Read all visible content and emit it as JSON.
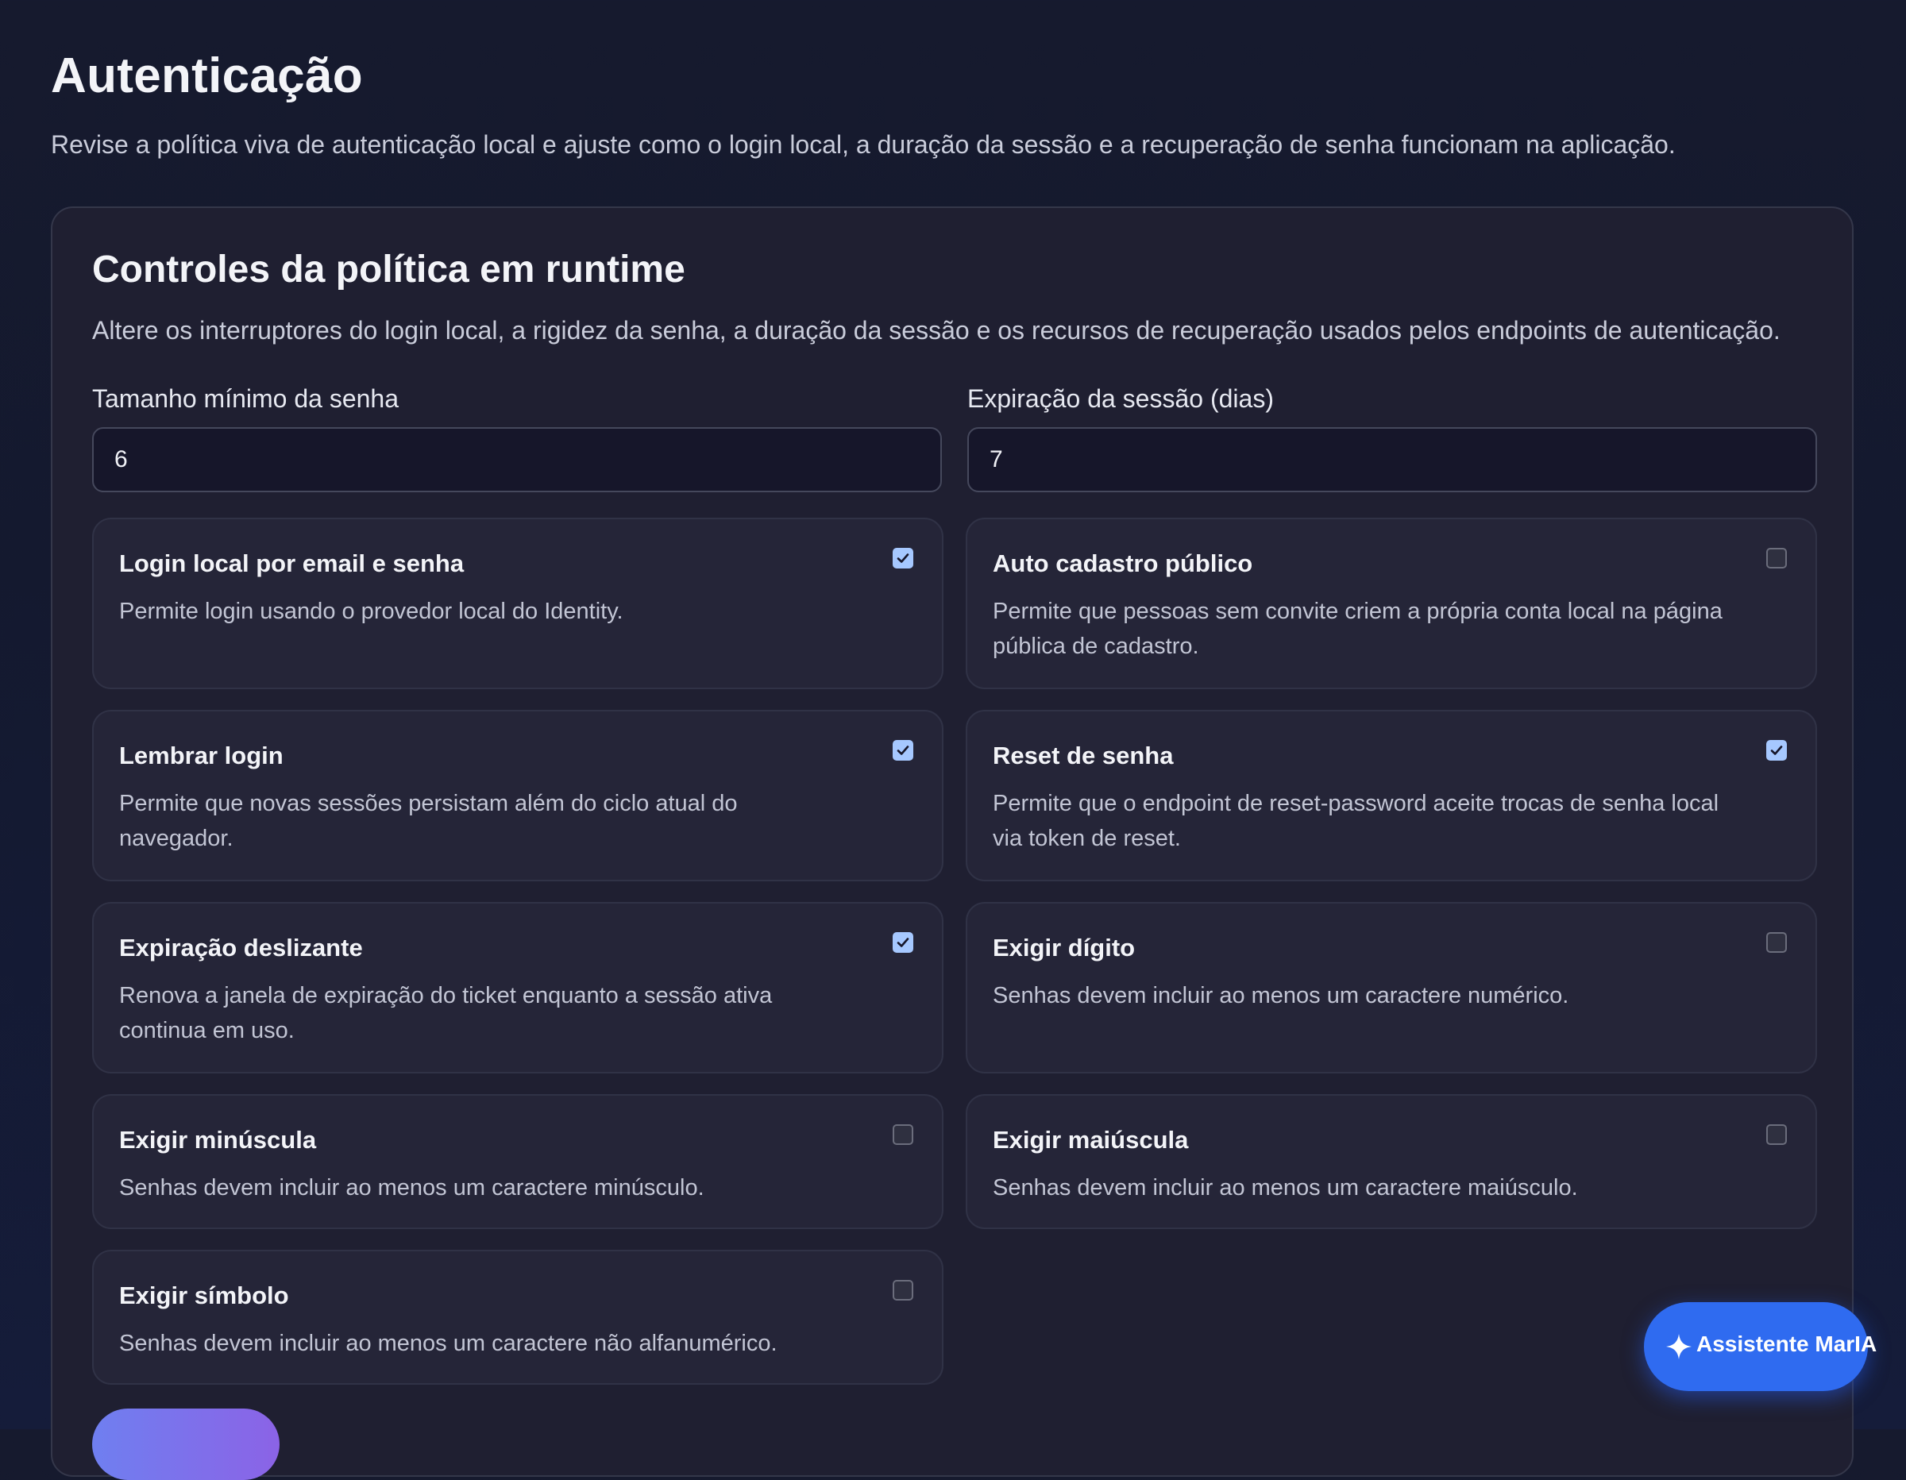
{
  "page": {
    "title": "Autenticação",
    "subtitle": "Revise a política viva de autenticação local e ajuste como o login local, a duração da sessão e a recuperação de senha funcionam na aplicação."
  },
  "panel": {
    "title": "Controles da política em runtime",
    "description": "Altere os interruptores do login local, a rigidez da senha, a duração da sessão e os recursos de recuperação usados pelos endpoints de autenticação."
  },
  "fields": {
    "min_password_length": {
      "label": "Tamanho mínimo da senha",
      "value": "6"
    },
    "session_expiration_days": {
      "label": "Expiração da sessão (dias)",
      "value": "7"
    }
  },
  "toggles": [
    {
      "title": "Login local por email e senha",
      "description": "Permite login usando o provedor local do Identity.",
      "checked": true
    },
    {
      "title": "Auto cadastro público",
      "description": "Permite que pessoas sem convite criem a própria conta local na página pública de cadastro.",
      "checked": false
    },
    {
      "title": "Lembrar login",
      "description": "Permite que novas sessões persistam além do ciclo atual do navegador.",
      "checked": true
    },
    {
      "title": "Reset de senha",
      "description": "Permite que o endpoint de reset-password aceite trocas de senha local via token de reset.",
      "checked": true
    },
    {
      "title": "Expiração deslizante",
      "description": "Renova a janela de expiração do ticket enquanto a sessão ativa continua em uso.",
      "checked": true
    },
    {
      "title": "Exigir dígito",
      "description": "Senhas devem incluir ao menos um caractere numérico.",
      "checked": false
    },
    {
      "title": "Exigir minúscula",
      "description": "Senhas devem incluir ao menos um caractere minúsculo.",
      "checked": false
    },
    {
      "title": "Exigir maiúscula",
      "description": "Senhas devem incluir ao menos um caractere maiúsculo.",
      "checked": false
    },
    {
      "title": "Exigir símbolo",
      "description": "Senhas devem incluir ao menos um caractere não alfanumérico.",
      "checked": false
    }
  ],
  "assistant": {
    "label": "Assistente MarIA",
    "icon": "sparkle-icon"
  },
  "colors": {
    "accent": "#2f6bf0",
    "checkbox_on": "#a6c8ff",
    "panel_bg": "#1f1f31"
  }
}
